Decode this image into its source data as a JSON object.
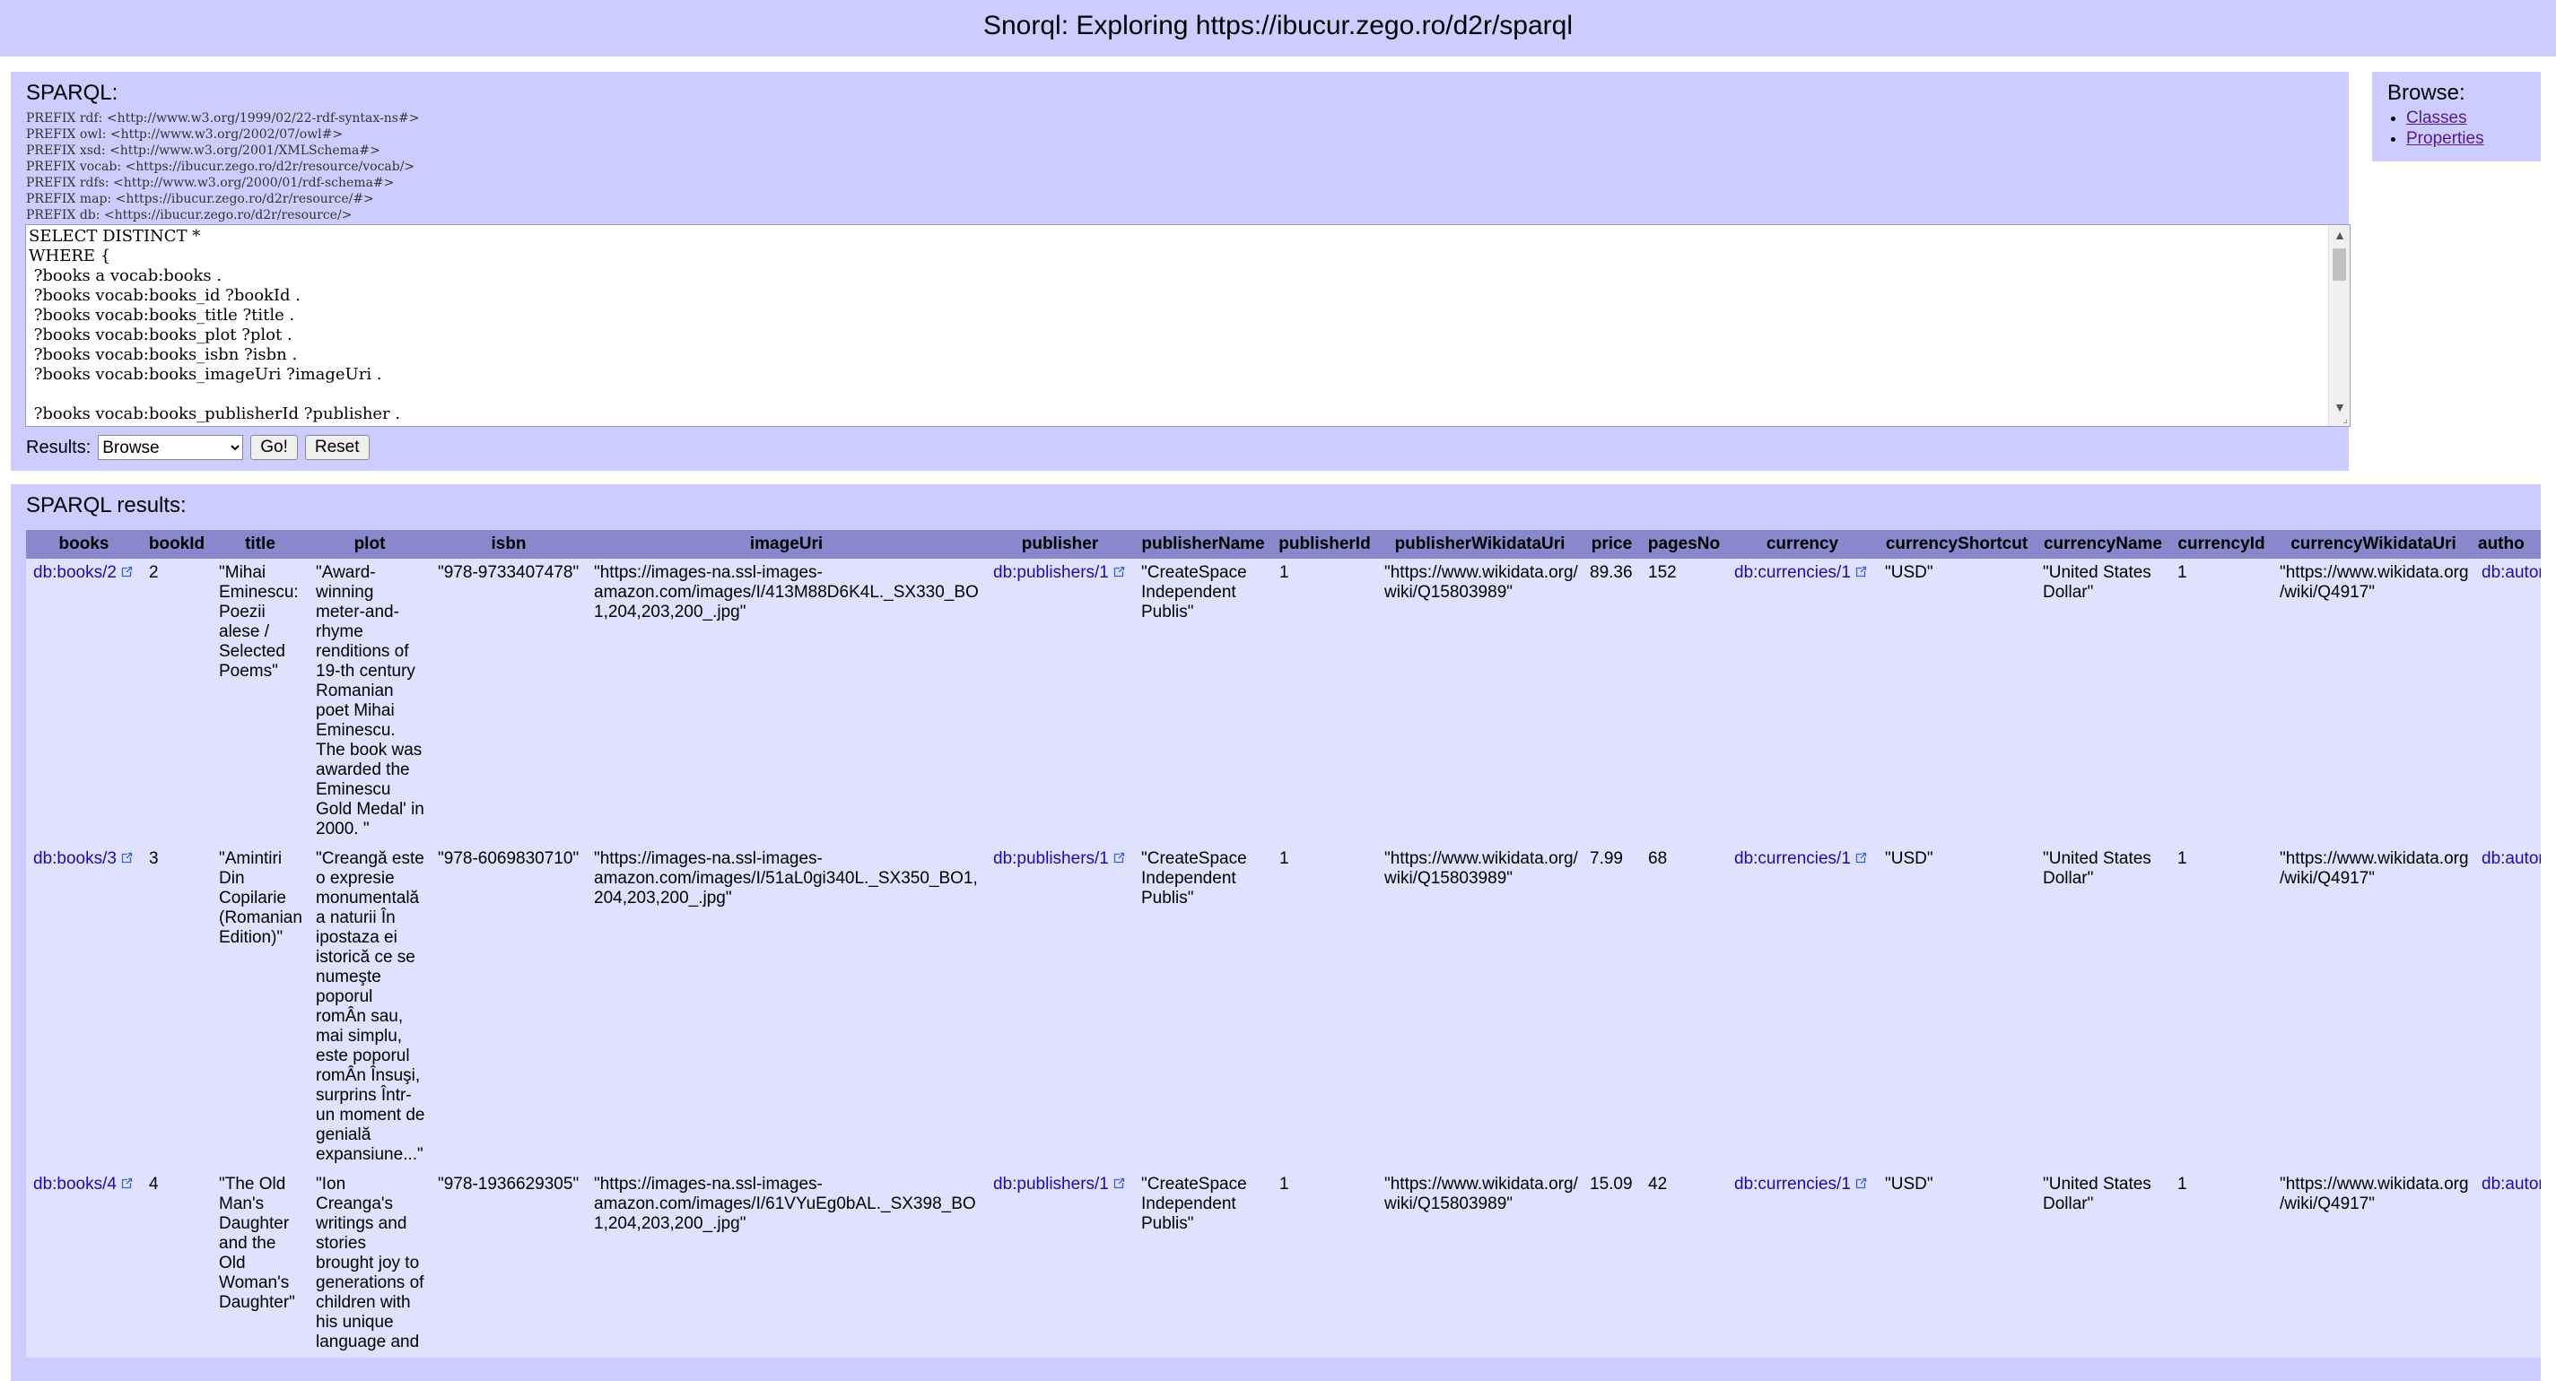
{
  "header": {
    "title": "Snorql: Exploring https://ibucur.zego.ro/d2r/sparql"
  },
  "query": {
    "label": "SPARQL:",
    "prefixes": "PREFIX rdf: <http://www.w3.org/1999/02/22-rdf-syntax-ns#>\nPREFIX owl: <http://www.w3.org/2002/07/owl#>\nPREFIX xsd: <http://www.w3.org/2001/XMLSchema#>\nPREFIX vocab: <https://ibucur.zego.ro/d2r/resource/vocab/>\nPREFIX rdfs: <http://www.w3.org/2000/01/rdf-schema#>\nPREFIX map: <https://ibucur.zego.ro/d2r/resource/#>\nPREFIX db: <https://ibucur.zego.ro/d2r/resource/>",
    "text": "SELECT DISTINCT *\nWHERE {\n ?books a vocab:books .\n ?books vocab:books_id ?bookId .\n ?books vocab:books_title ?title .\n ?books vocab:books_plot ?plot .\n ?books vocab:books_isbn ?isbn .\n ?books vocab:books_imageUri ?imageUri .\n\n ?books vocab:books_publisherId ?publisher .\n ?publisher vocab:publishers_name ?publisherName .",
    "results_label": "Results:",
    "results_selected": "Browse",
    "go_label": "Go!",
    "reset_label": "Reset"
  },
  "browse": {
    "label": "Browse:",
    "items": [
      "Classes",
      "Properties"
    ]
  },
  "results": {
    "label": "SPARQL results:",
    "columns": [
      "books",
      "bookId",
      "title",
      "plot",
      "isbn",
      "imageUri",
      "publisher",
      "publisherName",
      "publisherId",
      "publisherWikidataUri",
      "price",
      "pagesNo",
      "currency",
      "currencyShortcut",
      "currencyName",
      "currencyId",
      "currencyWikidataUri",
      "autho"
    ],
    "rows": [
      {
        "books": "db:books/2",
        "bookId": "2",
        "title": "\"Mihai Eminescu: Poezii alese / Selected Poems\"",
        "plot": "\"Award-winning meter-and-rhyme renditions of 19-th century Romanian poet Mihai Eminescu. The book was awarded the Eminescu Gold Medal' in 2000. \"",
        "isbn": "\"978-9733407478\"",
        "imageUri": "\"https://images-na.ssl-images-amazon.com/images/I/413M88D6K4L._SX330_BO1,204,203,200_.jpg\"",
        "publisher": "db:publishers/1",
        "publisherName": "\"CreateSpace Independent Publis\"",
        "publisherId": "1",
        "publisherWikidataUri": "\"https://www.wikidata.org/wiki/Q15803989\"",
        "price": "89.36",
        "pagesNo": "152",
        "currency": "db:currencies/1",
        "currencyShortcut": "\"USD\"",
        "currencyName": "\"United States Dollar\"",
        "currencyId": "1",
        "currencyWikidataUri": "\"https://www.wikidata.org/wiki/Q4917\"",
        "author": "db:autors/"
      },
      {
        "books": "db:books/3",
        "bookId": "3",
        "title": "\"Amintiri Din Copilarie (Romanian Edition)\"",
        "plot": "\"Creangă este o expresie monumentală a naturii În ipostaza ei istorică ce se numeşte poporul romÂn sau, mai simplu, este poporul romÂn Însuşi, surprins Într-un moment de genială expansiune...\"",
        "isbn": "\"978-6069830710\"",
        "imageUri": "\"https://images-na.ssl-images-amazon.com/images/I/51aL0gi340L._SX350_BO1,204,203,200_.jpg\"",
        "publisher": "db:publishers/1",
        "publisherName": "\"CreateSpace Independent Publis\"",
        "publisherId": "1",
        "publisherWikidataUri": "\"https://www.wikidata.org/wiki/Q15803989\"",
        "price": "7.99",
        "pagesNo": "68",
        "currency": "db:currencies/1",
        "currencyShortcut": "\"USD\"",
        "currencyName": "\"United States Dollar\"",
        "currencyId": "1",
        "currencyWikidataUri": "\"https://www.wikidata.org/wiki/Q4917\"",
        "author": "db:autors/"
      },
      {
        "books": "db:books/4",
        "bookId": "4",
        "title": "\"The Old Man's Daughter and the Old Woman's Daughter\"",
        "plot": "\"Ion Creanga's writings and stories brought joy to generations of children with his unique language and",
        "isbn": "\"978-1936629305\"",
        "imageUri": "\"https://images-na.ssl-images-amazon.com/images/I/61VYuEg0bAL._SX398_BO1,204,203,200_.jpg\"",
        "publisher": "db:publishers/1",
        "publisherName": "\"CreateSpace Independent Publis\"",
        "publisherId": "1",
        "publisherWikidataUri": "\"https://www.wikidata.org/wiki/Q15803989\"",
        "price": "15.09",
        "pagesNo": "42",
        "currency": "db:currencies/1",
        "currencyShortcut": "\"USD\"",
        "currencyName": "\"United States Dollar\"",
        "currencyId": "1",
        "currencyWikidataUri": "\"https://www.wikidata.org/wiki/Q4917\"",
        "author": "db:autors/"
      }
    ]
  },
  "colors": {
    "panel": "#ccccff",
    "header_row": "#8888cc",
    "row_odd": "#e0e0ff",
    "link": "#1a0dab"
  },
  "icons": {
    "external_link": "external-link-icon",
    "scroll_up": "chevron-up-icon",
    "scroll_down": "chevron-down-icon"
  }
}
